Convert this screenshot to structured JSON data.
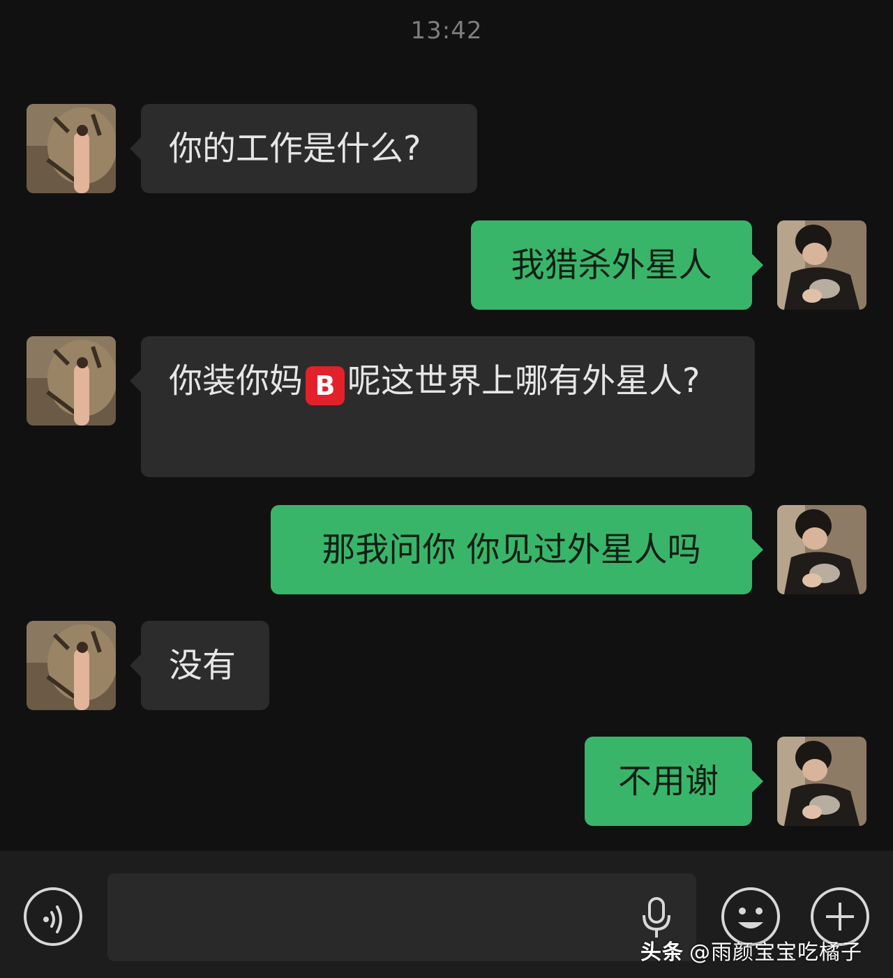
{
  "chat": {
    "timestamp": "13:42",
    "messages": [
      {
        "side": "left",
        "text": "你的工作是什么?"
      },
      {
        "side": "right",
        "text": "我猎杀外星人"
      },
      {
        "side": "left",
        "text_before": "你装你妈",
        "emoji": "B",
        "text_after": "呢这世界上哪有外星人?"
      },
      {
        "side": "right",
        "text": "那我问你 你见过外星人吗"
      },
      {
        "side": "left",
        "text": "没有"
      },
      {
        "side": "right",
        "text": "不用谢"
      }
    ]
  },
  "input_bar": {
    "voice_toggle_icon": "voice-icon",
    "mic_icon": "microphone-icon",
    "emoji_icon": "emoji-smile-icon",
    "add_icon": "plus-circle-icon"
  },
  "watermark": {
    "brand": "头条",
    "handle": "@雨颜宝宝吃橘子"
  },
  "colors": {
    "background": "#111111",
    "incoming_bubble": "#2c2c2c",
    "outgoing_bubble": "#39b56a",
    "emoji_badge": "#e3212b"
  }
}
